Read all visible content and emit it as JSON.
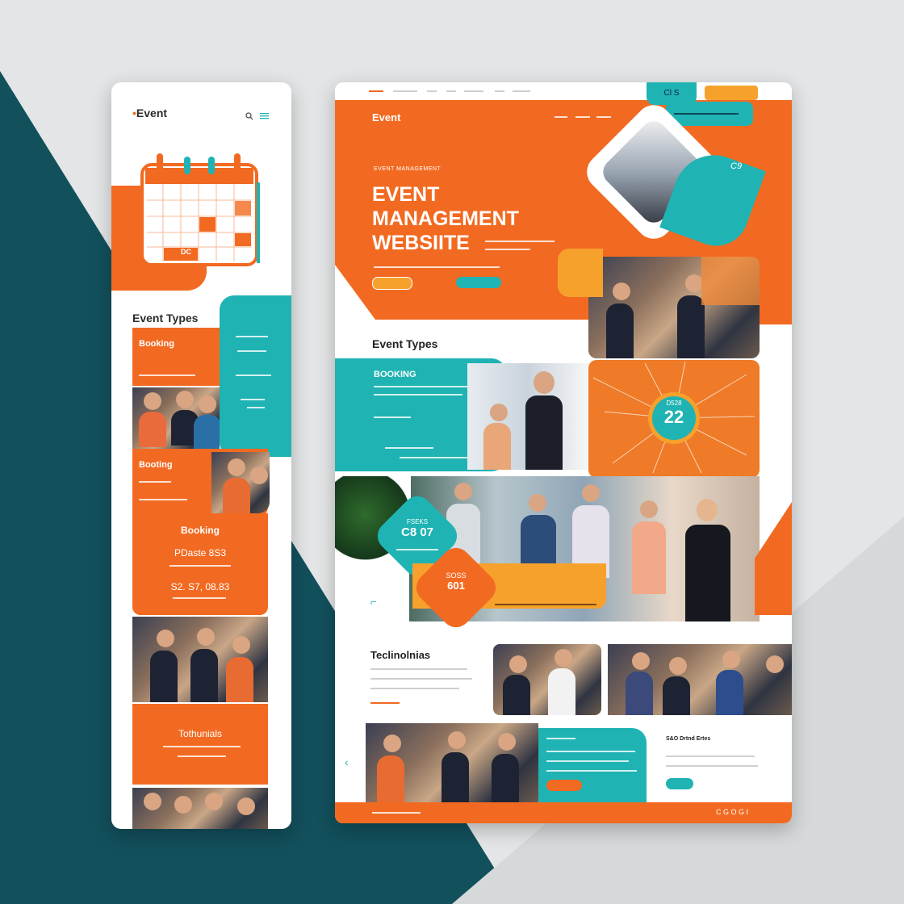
{
  "background": {
    "primary": "#e3e5e6",
    "accent": "#12505c"
  },
  "colors": {
    "orange": "#f26a21",
    "teal": "#1fb3b3",
    "white": "#ffffff"
  },
  "mobile": {
    "logo": "Event",
    "icons": [
      "search-icon",
      "menu-icon",
      "calendar-icon"
    ],
    "calendar_label": "DC",
    "section_title": "Event Types",
    "card1_title": "Booking",
    "card2_title": "Booting",
    "booking_title": "Booking",
    "booking_line1": "PDaste 8S3",
    "booking_line2": "S2. S7, 08.83",
    "testimonials_title": "Tothunials"
  },
  "desktop": {
    "topnav": [
      "",
      "",
      "",
      "",
      "",
      ""
    ],
    "logo": "Event",
    "hero_kicker": "EVENT MANAGEMENT",
    "hero_title_l1": "EVENT",
    "hero_title_l2": "MANAGEMENT",
    "hero_title_l3": "WEBSIITE",
    "badge_top": "Cl  S",
    "badge_side": "C9",
    "section_title": "Event Types",
    "booking_title": "BOOKING",
    "date_label": "D528",
    "date_number": "22",
    "teal_tag_l1": "FSEKS",
    "teal_tag_l2": "C8 07",
    "orange_tag_l1": "SOSS",
    "orange_tag_l2": "601",
    "testimonials_title": "Teclinolnias",
    "right_block_title": "S&O Drtnd Ertes",
    "footer_icons": [
      "chevron-left-icon"
    ],
    "footer_right": "C  G  O  G  I"
  }
}
